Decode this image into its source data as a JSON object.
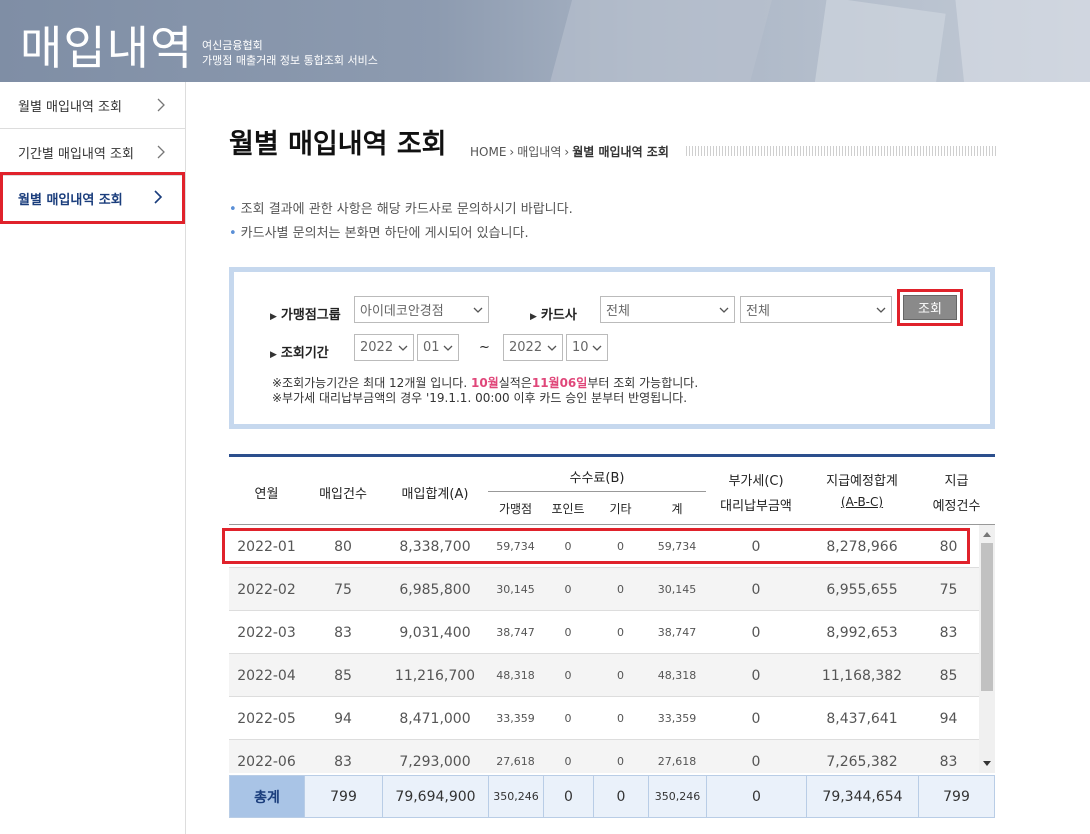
{
  "banner": {
    "title": "매입내역",
    "org": "여신금융협회",
    "service": "가맹점 매출거래 정보 통합조회 서비스"
  },
  "sidebar": {
    "items": [
      {
        "label": "월별 매입내역 조회",
        "active": false
      },
      {
        "label": "기간별 매입내역 조회",
        "active": false
      },
      {
        "label": "월별 매입내역 조회",
        "active": true
      }
    ]
  },
  "page": {
    "title": "월별 매입내역 조회",
    "breadcrumb": [
      "HOME",
      "매입내역",
      "월별 매입내역 조회"
    ],
    "notes": [
      "조회 결과에 관한 사항은 해당 카드사로 문의하시기 바랍니다.",
      "카드사별 문의처는 본화면 하단에 게시되어 있습니다."
    ]
  },
  "search": {
    "group_label": "가맹점그룹",
    "group_value": "아이데코안경점",
    "card_label": "카드사",
    "card_value_1": "전체",
    "card_value_2": "전체",
    "search_button": "조회",
    "period_label": "조회기간",
    "from_year": "2022",
    "from_month": "01",
    "tilde": "~",
    "to_year": "2022",
    "to_month": "10",
    "info1_pre": "※조회가능기간은 최대 12개월 입니다. ",
    "info1_em1": "10월",
    "info1_mid": "실적은",
    "info1_em2": "11월06일",
    "info1_post": "부터 조회 가능합니다.",
    "info2": "※부가세 대리납부금액의 경우 '19.1.1. 00:00 이후 카드 승인 분부터 반영됩니다."
  },
  "table": {
    "headers": {
      "month": "연월",
      "count": "매입건수",
      "total": "매입합계(A)",
      "fee": "수수료(B)",
      "fee_merchant": "가맹점",
      "fee_point": "포인트",
      "fee_other": "기타",
      "fee_sum": "계",
      "vat_1": "부가세(C)",
      "vat_2": "대리납부금액",
      "pay_1": "지급예정합계",
      "pay_2": "(A-B-C)",
      "paycnt_1": "지급",
      "paycnt_2": "예정건수"
    },
    "rows": [
      [
        "2022-01",
        "80",
        "8,338,700",
        "59,734",
        "0",
        "0",
        "59,734",
        "0",
        "8,278,966",
        "80"
      ],
      [
        "2022-02",
        "75",
        "6,985,800",
        "30,145",
        "0",
        "0",
        "30,145",
        "0",
        "6,955,655",
        "75"
      ],
      [
        "2022-03",
        "83",
        "9,031,400",
        "38,747",
        "0",
        "0",
        "38,747",
        "0",
        "8,992,653",
        "83"
      ],
      [
        "2022-04",
        "85",
        "11,216,700",
        "48,318",
        "0",
        "0",
        "48,318",
        "0",
        "11,168,382",
        "85"
      ],
      [
        "2022-05",
        "94",
        "8,471,000",
        "33,359",
        "0",
        "0",
        "33,359",
        "0",
        "8,437,641",
        "94"
      ],
      [
        "2022-06",
        "83",
        "7,293,000",
        "27,618",
        "0",
        "0",
        "27,618",
        "0",
        "7,265,382",
        "83"
      ]
    ],
    "totals": [
      "총계",
      "799",
      "79,694,900",
      "350,246",
      "0",
      "0",
      "350,246",
      "0",
      "79,344,654",
      "799"
    ]
  }
}
